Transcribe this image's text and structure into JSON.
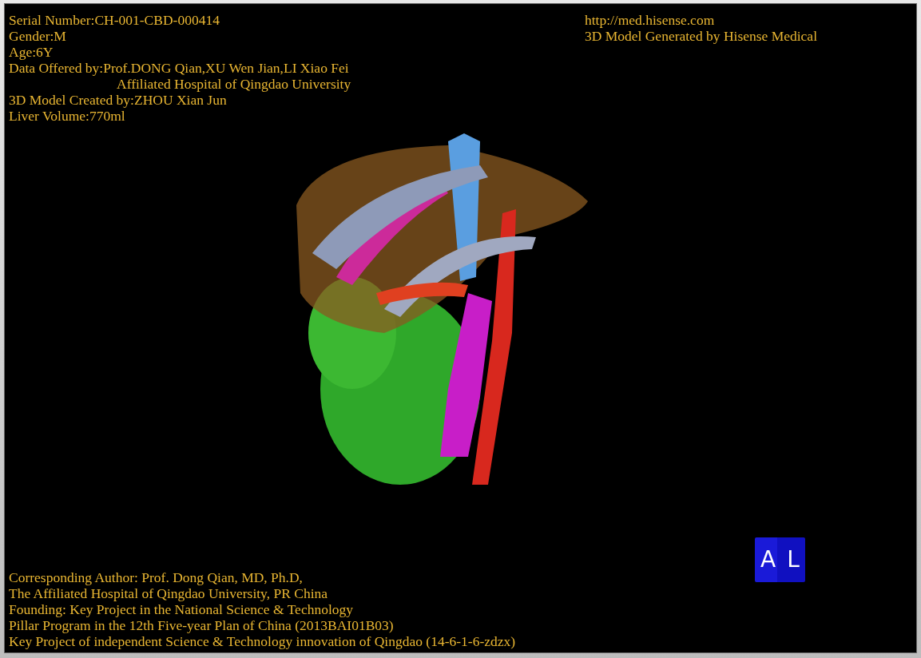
{
  "header_left": [
    {
      "text": "Serial Number:CH-001-CBD-000414",
      "kind": "line"
    },
    {
      "text": "Gender:M",
      "kind": "line"
    },
    {
      "text": "Age:6Y",
      "kind": "line"
    },
    {
      "text": "Data Offered by:Prof.DONG Qian,XU Wen Jian,LI Xiao Fei",
      "kind": "line"
    },
    {
      "text": "Affiliated Hospital of Qingdao University",
      "kind": "continuation"
    },
    {
      "text": "3D Model Created by:ZHOU Xian Jun",
      "kind": "line"
    },
    {
      "text": "Liver Volume:770ml",
      "kind": "line"
    }
  ],
  "header_right": [
    {
      "text": "http://med.hisense.com"
    },
    {
      "text": "3D Model Generated by Hisense Medical"
    }
  ],
  "footer": [
    {
      "text": "Corresponding Author: Prof. Dong Qian, MD, Ph.D,"
    },
    {
      "text": "The Affiliated Hospital of Qingdao University, PR China"
    },
    {
      "text": "Founding: Key Project in the National Science & Technology"
    },
    {
      "text": "Pillar Program in the 12th Five-year Plan of China (2013BAI01B03)"
    },
    {
      "text": "Key Project of independent Science & Technology innovation of Qingdao (14-6-1-6-zdzx)"
    }
  ],
  "orientation_cube": {
    "faces": [
      "A",
      "L"
    ]
  }
}
